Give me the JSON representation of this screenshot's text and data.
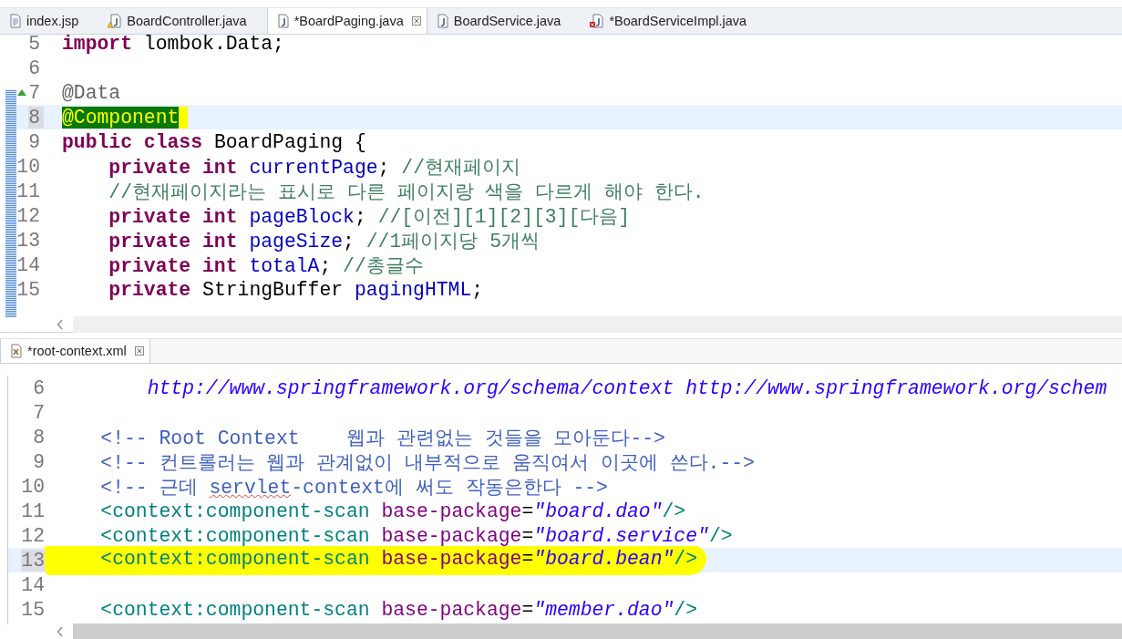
{
  "editors": [
    {
      "change_ruler": true,
      "tabs": [
        {
          "label": "index.jsp",
          "kind": "jsp",
          "selected": false
        },
        {
          "label": "BoardController.java",
          "kind": "javawarning",
          "selected": false
        },
        {
          "label": "*BoardPaging.java",
          "kind": "java",
          "selected": true
        },
        {
          "label": "BoardService.java",
          "kind": "java",
          "selected": false
        },
        {
          "label": "*BoardServiceImpl.java",
          "kind": "javaerror",
          "selected": false
        }
      ],
      "lines": [
        {
          "number": "5",
          "current": false,
          "highlighted": false,
          "tokens": [
            {
              "text": "import",
              "kind": "keyword"
            },
            {
              "text": " lombok.Data;",
              "kind": "plain"
            }
          ]
        },
        {
          "number": "6",
          "current": false
        },
        {
          "number": "7",
          "current": false,
          "highlighted": false,
          "override": true,
          "tokens": [
            {
              "text": "@Data",
              "kind": "annotation"
            }
          ]
        },
        {
          "number": "8",
          "current": true,
          "highlighted": false,
          "tokens": [
            {
              "text": "@Component",
              "kind": "annotation",
              "marked": true
            }
          ]
        },
        {
          "number": "9",
          "current": false,
          "highlighted": false,
          "tokens": [
            {
              "text": "public class",
              "kind": "keyword"
            },
            {
              "text": " BoardPaging {",
              "kind": "plain"
            }
          ]
        },
        {
          "number": "10",
          "current": false,
          "highlighted": false,
          "tokens": [
            {
              "text": "    private int",
              "kind": "keyword"
            },
            {
              "text": " currentPage",
              "kind": "field"
            },
            {
              "text": "; ",
              "kind": "plain"
            },
            {
              "text": "//현재페이지",
              "kind": "comment"
            }
          ]
        },
        {
          "number": "11",
          "current": false,
          "highlighted": false,
          "tokens": [
            {
              "text": "    //현재페이지라는 표시로 다른 페이지랑 색을 다르게 해야 한다.",
              "kind": "comment"
            }
          ]
        },
        {
          "number": "12",
          "current": false,
          "highlighted": false,
          "tokens": [
            {
              "text": "    private int",
              "kind": "keyword"
            },
            {
              "text": " pageBlock",
              "kind": "field"
            },
            {
              "text": "; ",
              "kind": "plain"
            },
            {
              "text": "//[이전][1][2][3][다음]",
              "kind": "comment"
            }
          ]
        },
        {
          "number": "13",
          "current": false,
          "highlighted": false,
          "tokens": [
            {
              "text": "    private int",
              "kind": "keyword"
            },
            {
              "text": " pageSize",
              "kind": "field"
            },
            {
              "text": "; ",
              "kind": "plain"
            },
            {
              "text": "//1페이지당 5개씩",
              "kind": "comment"
            }
          ]
        },
        {
          "number": "14",
          "current": false,
          "highlighted": false,
          "tokens": [
            {
              "text": "    private int",
              "kind": "keyword"
            },
            {
              "text": " totalA",
              "kind": "field"
            },
            {
              "text": "; ",
              "kind": "plain"
            },
            {
              "text": "//총글수",
              "kind": "comment"
            }
          ]
        },
        {
          "number": "15",
          "current": false,
          "highlighted": false,
          "tokens": [
            {
              "text": "    private",
              "kind": "keyword"
            },
            {
              "text": " StringBuffer ",
              "kind": "plain"
            },
            {
              "text": "pagingHTML",
              "kind": "field"
            },
            {
              "text": ";",
              "kind": "plain"
            }
          ]
        }
      ]
    },
    {
      "change_ruler": false,
      "tabs": [
        {
          "label": "*root-context.xml",
          "kind": "xml",
          "selected": true
        }
      ],
      "lines": [
        {
          "number": "6",
          "current": false,
          "highlighted": false,
          "tokens": [
            {
              "text": "        http://www.springframework.org/schema/context http://www.springframework.org/schem",
              "kind": "string"
            }
          ]
        },
        {
          "number": "7",
          "current": false
        },
        {
          "number": "8",
          "current": false,
          "highlighted": false,
          "tokens": [
            {
              "text": "    <!-- Root Context    웹과 관련없는 것들을 모아둔다-->",
              "kind": "comment"
            }
          ]
        },
        {
          "number": "9",
          "current": false,
          "highlighted": false,
          "tokens": [
            {
              "text": "    <!-- 컨트롤러는 웹과 관계없이 내부적으로 움직여서 이곳에 쓴다.-->",
              "kind": "comment"
            }
          ]
        },
        {
          "number": "10",
          "current": false,
          "highlighted": false,
          "tokens": [
            {
              "text": "    <!-- 근데 ",
              "kind": "comment"
            },
            {
              "text": "servlet",
              "kind": "comment",
              "misspelled": true
            },
            {
              "text": "-context에 써도 작동은한다 -->",
              "kind": "comment"
            }
          ]
        },
        {
          "number": "11",
          "current": false,
          "highlighted": false,
          "tokens": [
            {
              "text": "    <context:component-scan ",
              "kind": "tag"
            },
            {
              "text": "base-package",
              "kind": "attr"
            },
            {
              "text": "=",
              "kind": "plain"
            },
            {
              "text": "\"board.dao\"",
              "kind": "string"
            },
            {
              "text": "/>",
              "kind": "tag"
            }
          ]
        },
        {
          "number": "12",
          "current": false,
          "highlighted": false,
          "tokens": [
            {
              "text": "    <context:component-scan ",
              "kind": "tag"
            },
            {
              "text": "base-package",
              "kind": "attr"
            },
            {
              "text": "=",
              "kind": "plain"
            },
            {
              "text": "\"board.service\"",
              "kind": "string"
            },
            {
              "text": "/>",
              "kind": "tag"
            }
          ]
        },
        {
          "number": "13",
          "current": true,
          "highlighted": true,
          "tokens": [
            {
              "text": "    <context:component-scan ",
              "kind": "tag"
            },
            {
              "text": "base-package",
              "kind": "attr"
            },
            {
              "text": "=",
              "kind": "plain"
            },
            {
              "text": "\"board.bean\"",
              "kind": "string"
            },
            {
              "text": "/>",
              "kind": "tag"
            }
          ]
        },
        {
          "number": "14",
          "current": false
        },
        {
          "number": "15",
          "current": false,
          "highlighted": false,
          "tokens": [
            {
              "text": "    <context:component-scan ",
              "kind": "tag"
            },
            {
              "text": "base-package",
              "kind": "attr"
            },
            {
              "text": "=",
              "kind": "plain"
            },
            {
              "text": "\"member.dao\"",
              "kind": "string"
            },
            {
              "text": "/>",
              "kind": "tag"
            }
          ]
        }
      ]
    }
  ]
}
